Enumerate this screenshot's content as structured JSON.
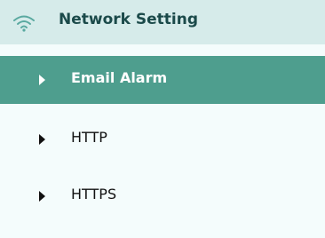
{
  "section": {
    "title": "Network Setting",
    "icon": "wifi-icon",
    "header_color": "#d6ebea",
    "icon_color": "#5aa9a0"
  },
  "menu": {
    "items": [
      {
        "label": "Email Alarm",
        "active": true
      },
      {
        "label": "HTTP",
        "active": false
      },
      {
        "label": "HTTPS",
        "active": false
      }
    ],
    "active_color": "#4e9e8e"
  }
}
